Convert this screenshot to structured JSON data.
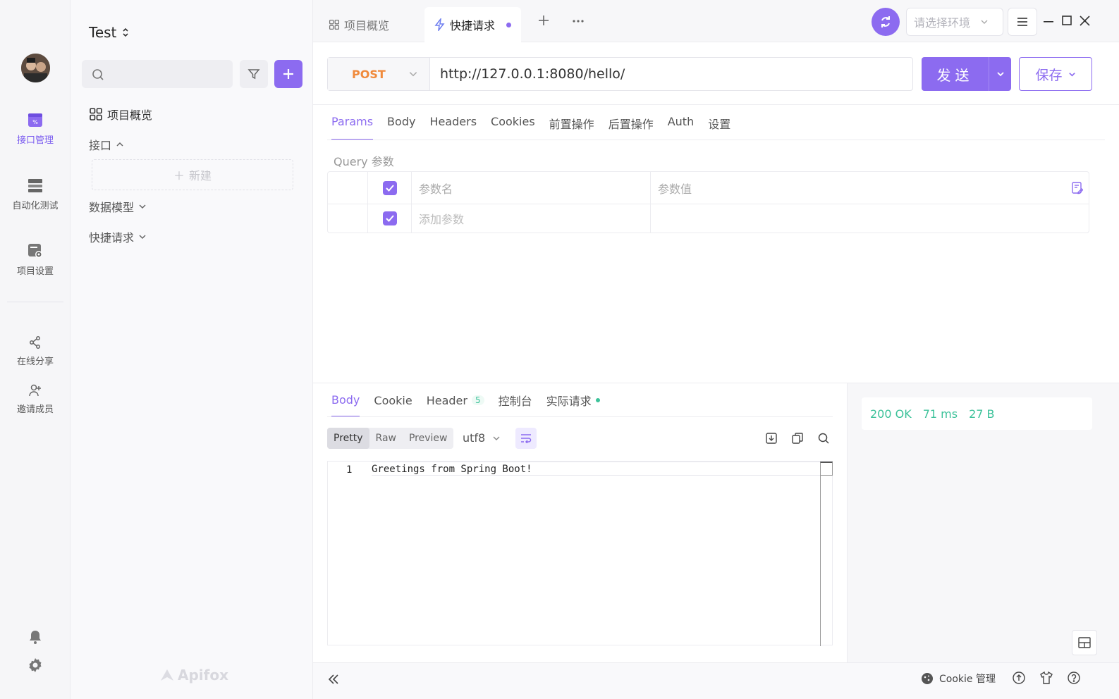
{
  "rail": {
    "items": [
      {
        "label": "接口管理",
        "icon": "api-management-icon",
        "active": true
      },
      {
        "label": "自动化测试",
        "icon": "automation-test-icon"
      },
      {
        "label": "项目设置",
        "icon": "project-settings-icon"
      },
      {
        "label": "在线分享",
        "icon": "share-icon"
      },
      {
        "label": "邀请成员",
        "icon": "invite-member-icon"
      }
    ]
  },
  "sidebar": {
    "project_name": "Test",
    "search_placeholder": "",
    "tree": {
      "overview": "项目概览",
      "api": "接口",
      "new": "新建",
      "models": "数据模型",
      "quick": "快捷请求"
    },
    "brand": "Apifox"
  },
  "tabs": [
    {
      "label": "项目概览"
    },
    {
      "label": "快捷请求",
      "active": true
    }
  ],
  "env": {
    "placeholder": "请选择环境"
  },
  "request": {
    "method": "POST",
    "url": "http://127.0.0.1:8080/hello/",
    "send_label": "发送",
    "save_label": "保存"
  },
  "param_tabs": [
    "Params",
    "Body",
    "Headers",
    "Cookies",
    "前置操作",
    "后置操作",
    "Auth",
    "设置"
  ],
  "query": {
    "label": "Query 参数",
    "header_name": "参数名",
    "header_value": "参数值",
    "add_placeholder": "添加参数"
  },
  "response": {
    "tabs": {
      "body": "Body",
      "cookie": "Cookie",
      "header": "Header",
      "header_count": "5",
      "console": "控制台",
      "actual": "实际请求"
    },
    "views": [
      "Pretty",
      "Raw",
      "Preview"
    ],
    "encoding": "utf8",
    "line_no": "1",
    "body": "Greetings from Spring Boot!",
    "status": "200 OK",
    "time": "71 ms",
    "size": "27 B"
  },
  "footer": {
    "cookie_label": "Cookie 管理"
  },
  "colors": {
    "accent": "#8c6bf0",
    "success": "#3dc29a",
    "method_post": "#f08a3c"
  }
}
